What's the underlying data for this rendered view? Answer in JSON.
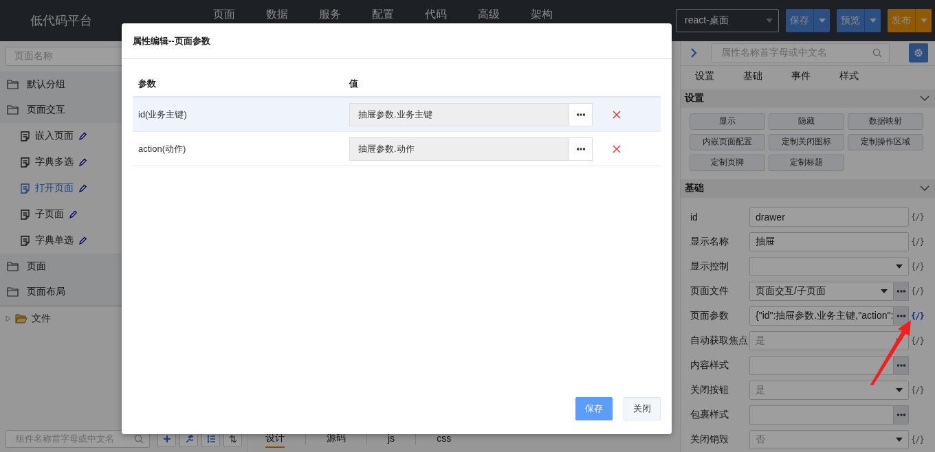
{
  "header": {
    "logo": "低代码平台",
    "nav": [
      "页面",
      "数据",
      "服务",
      "配置",
      "代码",
      "高级",
      "架构"
    ],
    "platform_select": "react-桌面",
    "buttons": [
      {
        "label": "保存",
        "kind": "primary"
      },
      {
        "label": "预览",
        "kind": "primary"
      },
      {
        "label": "发布",
        "kind": "warning"
      }
    ]
  },
  "sidebar": {
    "search": {
      "placeholder": "页面名称"
    },
    "groups": [
      {
        "label": "默认分组",
        "selected": false
      },
      {
        "label": "页面交互",
        "selected": false,
        "children": [
          {
            "label": "嵌入页面",
            "selected": false
          },
          {
            "label": "字典多选",
            "selected": false
          },
          {
            "label": "打开页面",
            "selected": true
          },
          {
            "label": "子页面",
            "selected": false
          },
          {
            "label": "字典单选",
            "selected": false
          }
        ]
      },
      {
        "label": "页面",
        "selected": false
      },
      {
        "label": "页面布局",
        "selected": false
      }
    ],
    "files": [
      {
        "label": "文件",
        "expanded": false
      }
    ],
    "component_search": {
      "placeholder": "组件名称首字母或中文名"
    }
  },
  "editor_tabs": [
    {
      "label": "设计",
      "selected": true
    },
    {
      "label": "源码",
      "selected": false
    },
    {
      "label": "js",
      "selected": false
    },
    {
      "label": "css",
      "selected": false
    }
  ],
  "properties": {
    "search": {
      "placeholder": "属性名称首字母或中文名"
    },
    "tabs": [
      {
        "label": "设置",
        "selected": false
      },
      {
        "label": "基础",
        "selected": false
      },
      {
        "label": "事件",
        "selected": false
      },
      {
        "label": "样式",
        "selected": false
      }
    ],
    "sections": [
      {
        "title": "设置",
        "kind": "buttons",
        "expanded": true,
        "buttons": [
          "显示",
          "隐藏",
          "数据映射",
          "内嵌页面配置",
          "定制关闭图标",
          "定制操作区域",
          "定制页脚",
          "定制标题"
        ]
      },
      {
        "title": "基础",
        "kind": "form",
        "expanded": true,
        "rows": [
          {
            "label": "id",
            "kind": "text",
            "value": "drawer",
            "expr": "{/}",
            "expr_active": false
          },
          {
            "label": "显示名称",
            "kind": "text",
            "value": "抽屉",
            "expr": "{/}",
            "expr_active": false
          },
          {
            "label": "显示控制",
            "kind": "select",
            "expr": "{/}",
            "expr_active": false
          },
          {
            "label": "页面文件",
            "kind": "select-more",
            "value": "页面交互/子页面",
            "expr": "{/}",
            "expr_active": false
          },
          {
            "label": "页面参数",
            "kind": "text-more",
            "value": "{\"id\":抽屉参数.业务主键,\"action\":",
            "expr": "{/}",
            "expr_active": true
          },
          {
            "label": "自动获取焦点",
            "kind": "select",
            "placeholder": "是",
            "expr": "{/}",
            "expr_active": false
          },
          {
            "label": "内容样式",
            "kind": "text-more"
          },
          {
            "label": "关闭按钮",
            "kind": "select",
            "placeholder": "是",
            "expr": "{/}",
            "expr_active": false
          },
          {
            "label": "包裹样式",
            "kind": "text-more"
          },
          {
            "label": "关闭销毁",
            "kind": "select",
            "placeholder": "否",
            "expr": "{/}",
            "expr_active": false
          }
        ]
      }
    ]
  },
  "dialog": {
    "title": "属性编辑--页面参数",
    "columns": [
      "参数",
      "值"
    ],
    "rows": [
      {
        "param": "id(业务主键)",
        "value": "抽屉参数.业务主键",
        "selected": true
      },
      {
        "param": "action(动作)",
        "value": "抽屉参数.动作",
        "selected": false
      }
    ],
    "buttons": [
      {
        "label": "保存",
        "kind": "primary"
      },
      {
        "label": "关闭",
        "kind": "default"
      }
    ]
  }
}
